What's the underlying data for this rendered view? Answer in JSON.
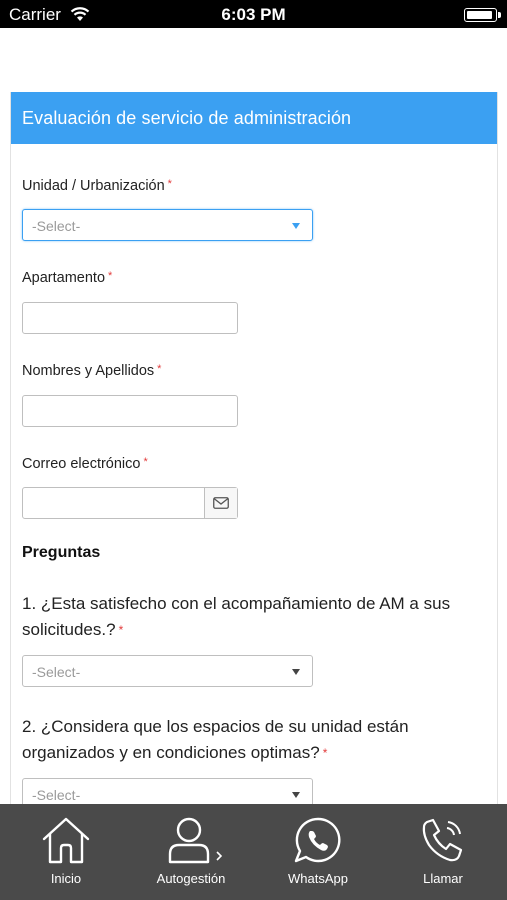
{
  "status_bar": {
    "carrier": "Carrier",
    "time": "6:03 PM"
  },
  "form": {
    "title": "Evaluación de servicio de administración",
    "required_mark": "*",
    "fields": {
      "unidad": {
        "label": "Unidad / Urbanización",
        "placeholder": "-Select-"
      },
      "apartamento": {
        "label": "Apartamento",
        "value": ""
      },
      "nombres": {
        "label": "Nombres y Apellidos",
        "value": ""
      },
      "correo": {
        "label": "Correo electrónico",
        "value": ""
      }
    },
    "section_title": "Preguntas",
    "questions": [
      {
        "text": "1. ¿Esta satisfecho con el acompañamiento de AM a sus solicitudes.?",
        "placeholder": "-Select-"
      },
      {
        "text": "2. ¿Considera que los espacios de su unidad están organizados y en condiciones optimas?",
        "placeholder": "-Select-"
      }
    ]
  },
  "bottom_nav": {
    "items": [
      {
        "label": "Inicio",
        "icon": "home-icon"
      },
      {
        "label": "Autogestión",
        "icon": "user-icon"
      },
      {
        "label": "WhatsApp",
        "icon": "whatsapp-icon"
      },
      {
        "label": "Llamar",
        "icon": "phone-icon"
      }
    ]
  },
  "colors": {
    "header_blue": "#3ba0f2",
    "nav_background": "#4a4a4a",
    "required_red": "#e23b3b"
  }
}
